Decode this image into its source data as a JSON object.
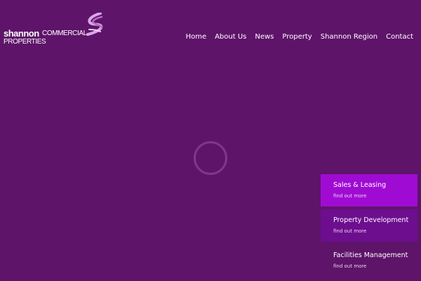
{
  "brand": {
    "name_bold": "shannon",
    "name_light": "COMMERCIAL",
    "name_line2": "PROPERTIES"
  },
  "nav": {
    "items": [
      "Home",
      "About Us",
      "News",
      "Property",
      "Shannon Region",
      "Contact"
    ]
  },
  "panels": [
    {
      "title": "Sales & Leasing",
      "link": "find out more"
    },
    {
      "title": "Property Development",
      "link": "find out more"
    },
    {
      "title": "Facilities Management",
      "link": "find out more"
    }
  ],
  "colors": {
    "background": "#5e1469",
    "panel_active": "#a00bd3",
    "panel_secondary": "#6d0e8f",
    "loader_ring": "#7c3a86"
  },
  "icons": {
    "logo_mark": "ribbon-swirl-icon",
    "loader": "loading-spinner-icon"
  }
}
